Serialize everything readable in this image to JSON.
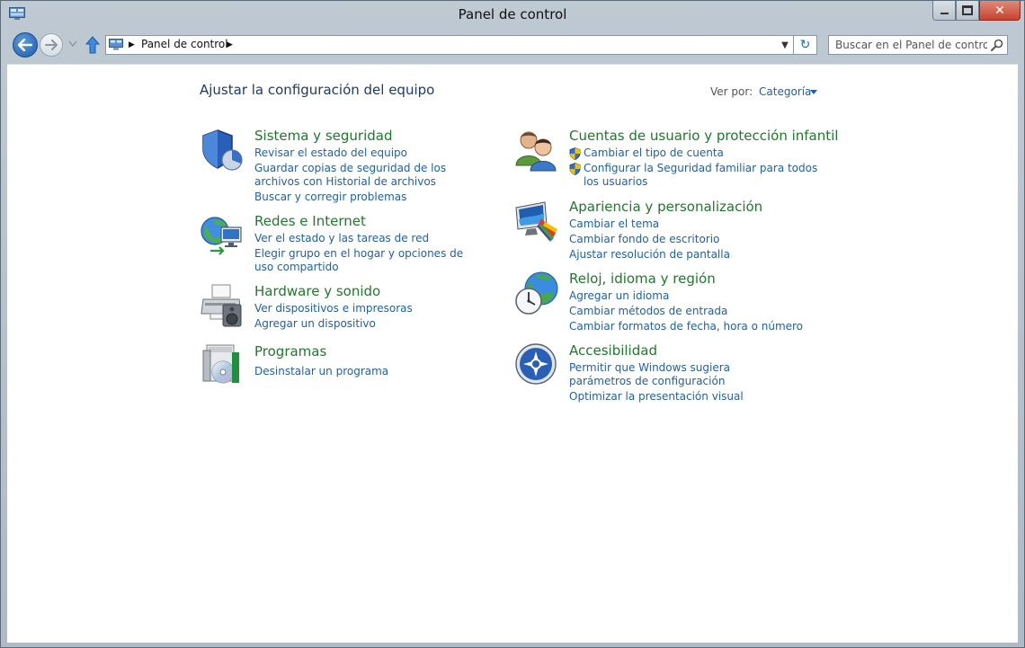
{
  "window": {
    "title": "Panel de control"
  },
  "address": {
    "crumb": "Panel de control"
  },
  "search": {
    "placeholder": "Buscar en el Panel de control"
  },
  "header": {
    "heading": "Ajustar la configuración del equipo",
    "view_by_label": "Ver por:",
    "view_by_value": "Categoría"
  },
  "left_categories": [
    {
      "title": "Sistema y seguridad",
      "links": [
        "Revisar el estado del equipo",
        "Guardar copias de seguridad de los archivos con Historial de archivos",
        "Buscar y corregir problemas"
      ]
    },
    {
      "title": "Redes e Internet",
      "links": [
        "Ver el estado y las tareas de red",
        "Elegir grupo en el hogar y opciones de uso compartido"
      ]
    },
    {
      "title": "Hardware y sonido",
      "links": [
        "Ver dispositivos e impresoras",
        "Agregar un dispositivo"
      ]
    },
    {
      "title": "Programas",
      "links": [
        "Desinstalar un programa"
      ]
    }
  ],
  "right_categories": [
    {
      "title": "Cuentas de usuario y protección infantil",
      "links": [
        "Cambiar el tipo de cuenta",
        "Configurar la Seguridad familiar para todos los usuarios"
      ]
    },
    {
      "title": "Apariencia y personalización",
      "links": [
        "Cambiar el tema",
        "Cambiar fondo de escritorio",
        "Ajustar resolución de pantalla"
      ]
    },
    {
      "title": "Reloj, idioma y región",
      "links": [
        "Agregar un idioma",
        "Cambiar métodos de entrada",
        "Cambiar formatos de fecha, hora o número"
      ]
    },
    {
      "title": "Accesibilidad",
      "links": [
        "Permitir que Windows sugiera parámetros de configuración",
        "Optimizar la presentación visual"
      ]
    }
  ],
  "colors": {
    "category_title": "#1e7a2a",
    "link": "#1f5fae",
    "heading": "#1e3a6b"
  }
}
